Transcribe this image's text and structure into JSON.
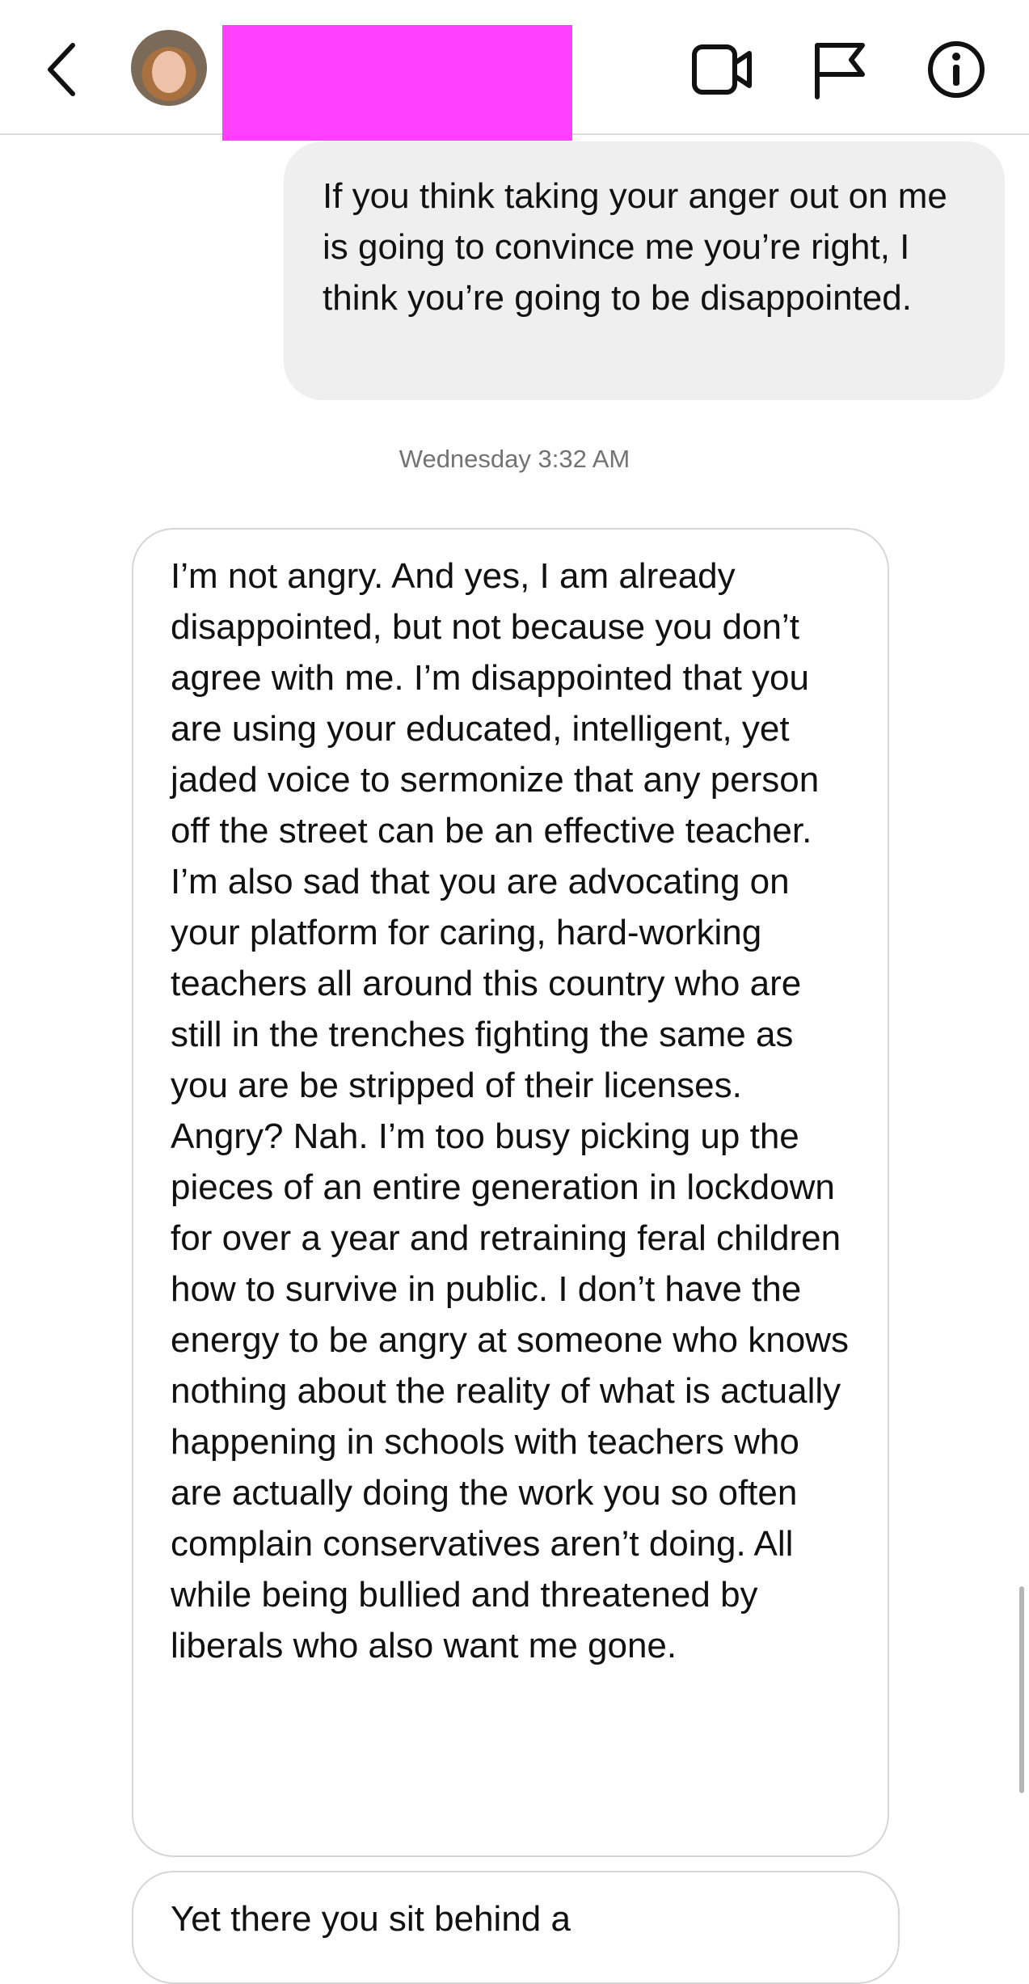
{
  "header": {
    "back_icon": "chevron-left-icon",
    "avatar_icon": "user-avatar",
    "video_icon": "video-camera-icon",
    "flag_icon": "flag-icon",
    "info_icon": "info-icon",
    "redaction_color": "#ff40ff"
  },
  "messages": {
    "sent_1": "If you think taking your anger out on me is going to convince me you’re right, I think you’re going to be disappointed.",
    "timestamp": "Wednesday 3:32 AM",
    "received_1": "I’m not angry. And yes, I am already disappointed, but not because you don’t agree with me. I’m disappointed that you are using your educated, intelligent, yet jaded voice to sermonize that any person off the street can be an effective teacher. I’m also sad that you are advocating on your platform for caring, hard-working teachers all around this country who are still in the trenches fighting the same as you are be stripped of their licenses. Angry? Nah. I’m too busy picking up the pieces of an entire generation in lockdown for over a year and retraining feral children how to survive in public. I don’t have the energy to be angry at someone who knows nothing about the reality of what is actually happening in schools with teachers who are actually doing the work you so often complain conservatives aren’t doing. All while being bullied and threatened by liberals who also want me gone.",
    "received_2_partial": "Yet there you sit behind a"
  },
  "colors": {
    "sent_bubble": "#efefef",
    "received_border": "#d6d6d6",
    "timestamp_text": "#737373"
  }
}
